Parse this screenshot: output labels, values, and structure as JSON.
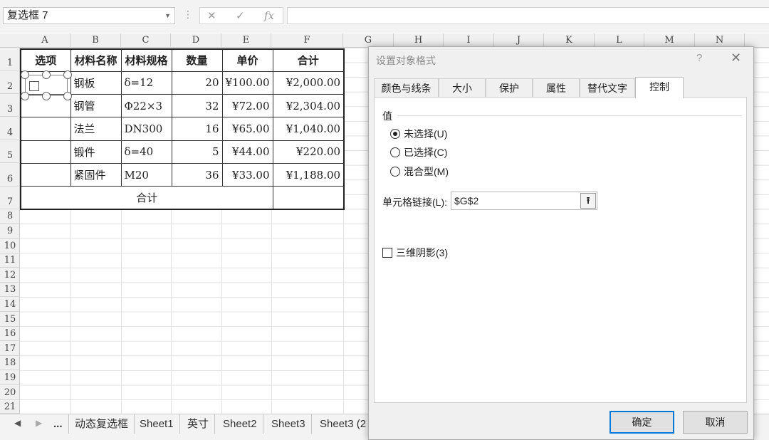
{
  "formula_bar": {
    "name_box": "复选框 7",
    "cancel_icon": "✕",
    "enter_icon": "✓",
    "fx_label": "fx",
    "formula": ""
  },
  "columns": [
    "A",
    "B",
    "C",
    "D",
    "E",
    "F",
    "G",
    "H",
    "I",
    "J",
    "K",
    "L",
    "M",
    "N"
  ],
  "rows": [
    "1",
    "2",
    "3",
    "4",
    "5",
    "6",
    "7",
    "8",
    "9",
    "10",
    "11",
    "12",
    "13",
    "14",
    "15",
    "16",
    "17",
    "18",
    "19",
    "20",
    "21"
  ],
  "table": {
    "headers": [
      "选项",
      "材料名称",
      "材料规格",
      "数量",
      "单价",
      "合计"
    ],
    "rows": [
      [
        "",
        "钢板",
        "δ=12",
        "20",
        "¥100.00",
        "¥2,000.00"
      ],
      [
        "",
        "钢管",
        "Φ22×3",
        "32",
        "¥72.00",
        "¥2,304.00"
      ],
      [
        "",
        "法兰",
        "DN300",
        "16",
        "¥65.00",
        "¥1,040.00"
      ],
      [
        "",
        "锻件",
        "δ=40",
        "5",
        "¥44.00",
        "¥220.00"
      ],
      [
        "",
        "紧固件",
        "M20",
        "36",
        "¥33.00",
        "¥1,188.00"
      ]
    ],
    "total_label": "合计",
    "total_value": ""
  },
  "sheet_tabs": {
    "more": "...",
    "tabs": [
      "动态复选框",
      "Sheet1",
      "英寸",
      "Sheet2",
      "Sheet3",
      "Sheet3 (2"
    ]
  },
  "dialog": {
    "title": "设置对象格式",
    "help": "?",
    "close": "✕",
    "tabs": [
      "颜色与线条",
      "大小",
      "保护",
      "属性",
      "替代文字",
      "控制"
    ],
    "active_tab": "控制",
    "value_group": "值",
    "radios": [
      {
        "label": "未选择(U)",
        "checked": true
      },
      {
        "label": "已选择(C)",
        "checked": false
      },
      {
        "label": "混合型(M)",
        "checked": false
      }
    ],
    "cell_link_label": "单元格链接(L):",
    "cell_link_value": "$G$2",
    "shading_label": "三维阴影(3)",
    "shading_checked": false,
    "ok": "确定",
    "cancel": "取消"
  }
}
